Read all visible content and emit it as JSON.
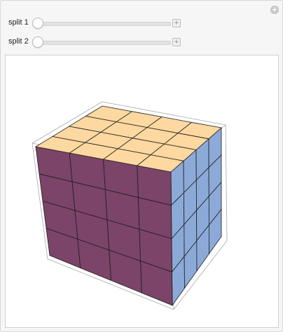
{
  "controls": [
    {
      "label": "split 1",
      "value_fraction": 0
    },
    {
      "label": "split 2",
      "value_fraction": 0
    }
  ],
  "plus_icon_glyph": "+",
  "cube": {
    "grid_divisions": 4,
    "colors": {
      "top": "#fdd8a0",
      "front": "#7b4468",
      "right": "#8caad8",
      "edge": "#1e1e1e",
      "bounding_box": "#a8a8a8"
    }
  }
}
